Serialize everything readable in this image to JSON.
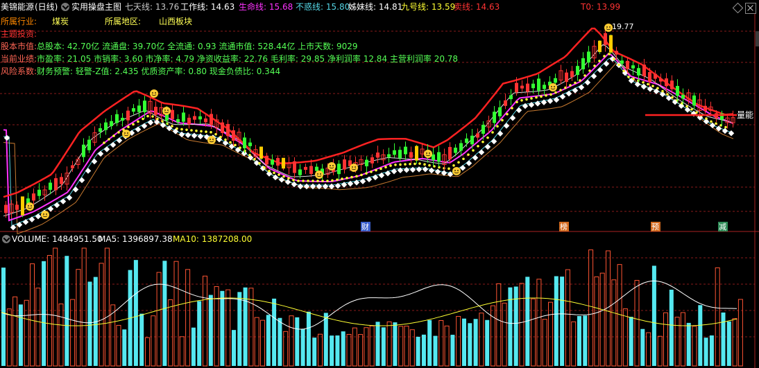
{
  "header": {
    "stock": "美锦能源",
    "period": "(日线)",
    "indicator": "实用操盘主图",
    "items": [
      {
        "label": "七天线: ",
        "value": "13.76",
        "color": "#c8c8c8"
      },
      {
        "label": "工作线: ",
        "value": "14.63",
        "color": "#ffffff"
      },
      {
        "label": "生命线: ",
        "value": "15.68",
        "color": "#ff33ff"
      },
      {
        "label": "不惑线: ",
        "value": "15.80",
        "color": "#55d7e6"
      },
      {
        "label": "姊妹线: ",
        "value": "14.81",
        "color": "#ffffff"
      },
      {
        "label": "九号线: ",
        "value": "13.59",
        "color": "#ffff33"
      },
      {
        "label": "卖线: ",
        "value": "14.63",
        "color": "#ff3333"
      }
    ],
    "t0": "T0: 13.99"
  },
  "info": {
    "industry_label": "所属行业:",
    "industry": "煤炭",
    "region_label": "所属地区:",
    "region": "山西板块",
    "theme_label": "主题投资:",
    "equity_label": "股本市值:",
    "equity": "总股本: 42.70亿 流通盘: 39.70亿 全流通: 0.93 流通市值: 528.44亿 上市天数: 9029",
    "perf_label": "当前业绩:",
    "perf": "市盈率: 21.05 市销率: 3.60 市净率: 4.79 净资收益率: 22.76 毛利率: 29.85 净利润率 12.84 主营利润率 20.78",
    "risk_label": "风险系数:",
    "risk": "财务预警: 轻警-Z值: 2.435 优质资产率: 0.80 现金负债比: 0.344"
  },
  "chart_labels": {
    "high": "19.77",
    "right_tag": "量能",
    "markers": [
      "财",
      "榜",
      "预",
      "减"
    ]
  },
  "volume": {
    "label": "VOLUME: 1484951.50",
    "ma5": "MA5: 1396897.38",
    "ma10": "MA10: 1387208.00"
  },
  "colors": {
    "up": "#ff3333",
    "down": "#33ff33",
    "vol_up": "#ff5533",
    "vol_down": "#55e8f0",
    "grid": "#8a1a1a"
  }
}
